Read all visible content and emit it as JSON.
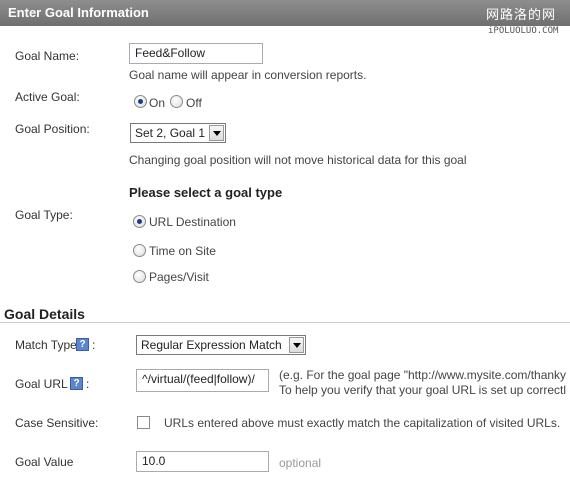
{
  "header": {
    "title": "Enter Goal Information",
    "watermark": "网路洛的网",
    "watermark_sub": "iPOLUOLUO.COM"
  },
  "goal_info": {
    "name_label": "Goal Name:",
    "name_value": "Feed&Follow",
    "name_hint": "Goal name will appear in conversion reports.",
    "active_label": "Active Goal:",
    "active_on": "On",
    "active_off": "Off",
    "position_label": "Goal Position:",
    "position_value": "Set 2, Goal 1",
    "position_hint": "Changing goal position will not move historical data for this goal",
    "type_heading": "Please select a goal type",
    "type_label": "Goal Type:",
    "type_options": [
      "URL Destination",
      "Time on Site",
      "Pages/Visit"
    ]
  },
  "goal_details": {
    "title": "Goal Details",
    "match_type_label": "Match Type",
    "match_type_value": "Regular Expression Match",
    "goal_url_label": "Goal URL",
    "goal_url_value": "^/virtual/(feed|follow)/",
    "goal_url_hint_1": "(e.g. For the goal page \"http://www.mysite.com/thanky",
    "goal_url_hint_2": "To help you verify that your goal URL is set up correctl",
    "case_label": "Case Sensitive:",
    "case_text": "URLs entered above must exactly match the capitalization of visited URLs.",
    "value_label": "Goal Value",
    "value_value": "10.0",
    "value_hint": "optional",
    "help_glyph": "?",
    "colon": ":"
  }
}
